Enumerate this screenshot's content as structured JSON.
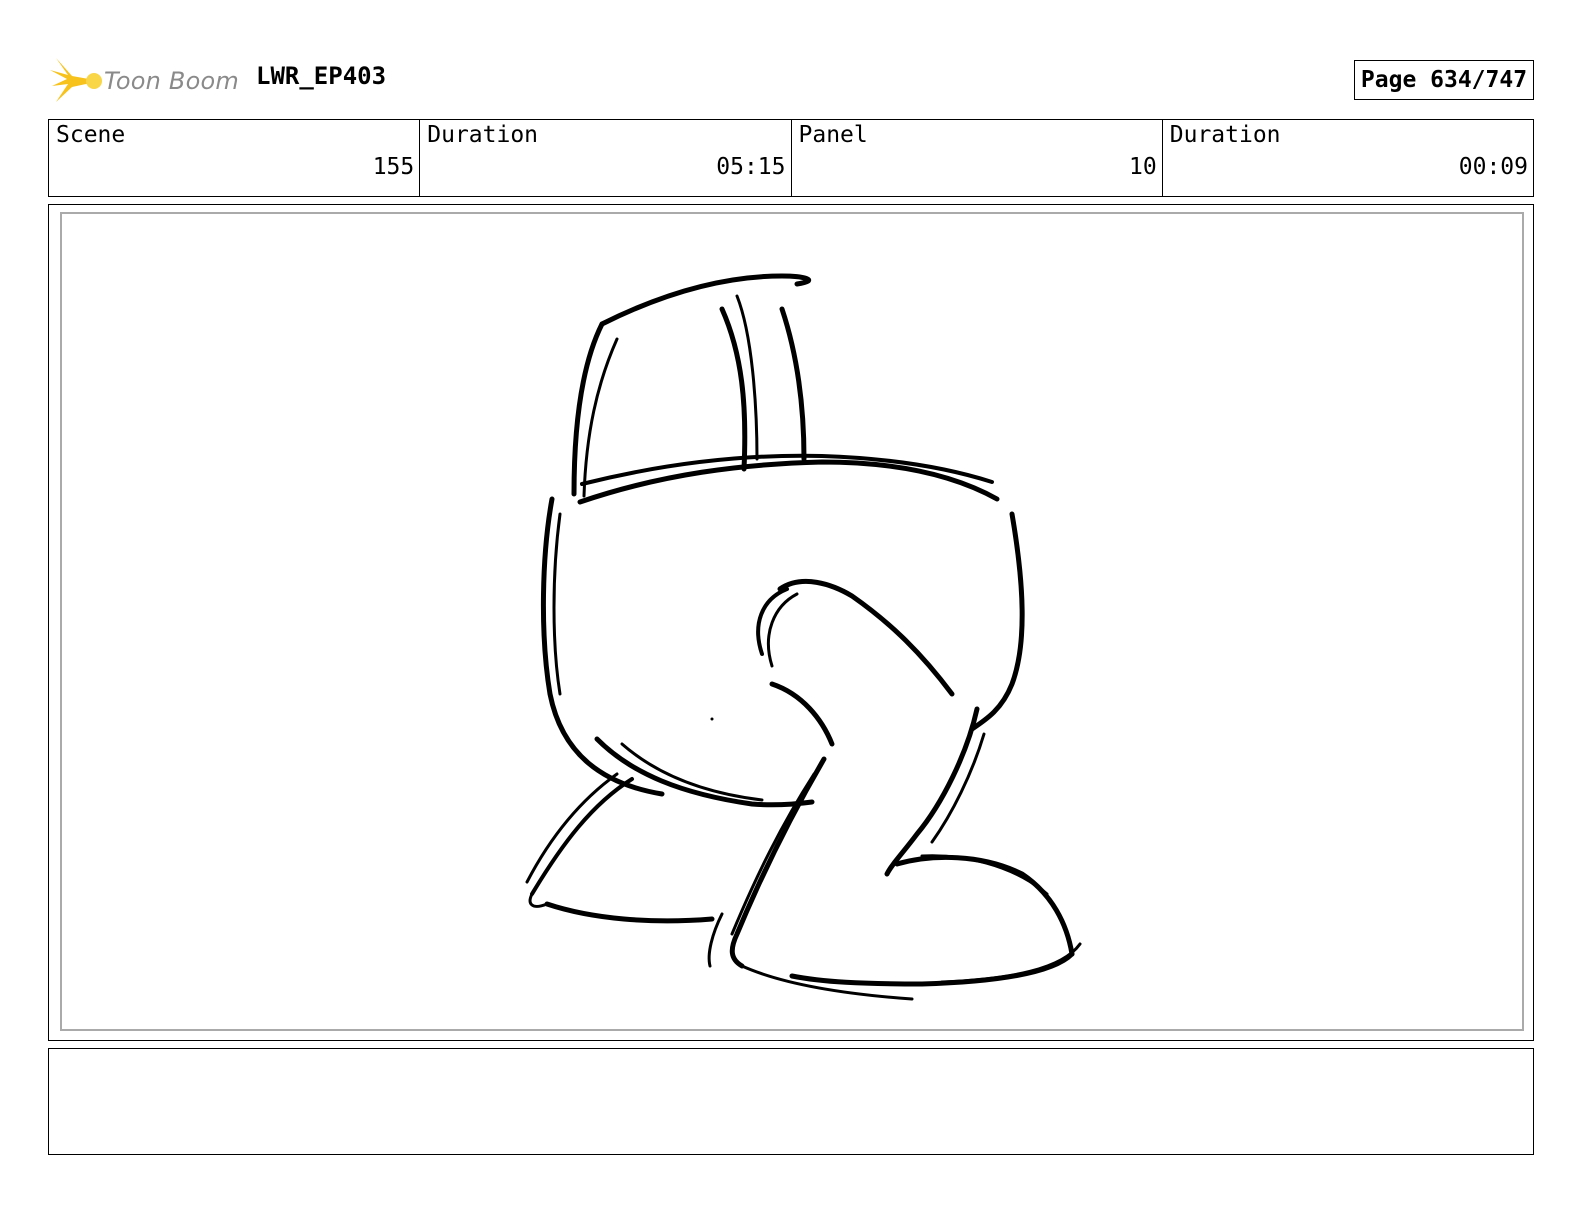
{
  "header": {
    "logo_text": "Toon Boom",
    "project_name": "LWR_EP403",
    "page_label": "Page 634/747"
  },
  "info": {
    "scene_label": "Scene",
    "scene_value": "155",
    "scene_duration_label": "Duration",
    "scene_duration_value": "05:15",
    "panel_label": "Panel",
    "panel_value": "10",
    "panel_duration_label": "Duration",
    "panel_duration_value": "00:09"
  },
  "colors": {
    "logo_accent": "#f7c21b",
    "logo_text": "#8a8a8a",
    "panel_border": "#aaaaaa"
  }
}
